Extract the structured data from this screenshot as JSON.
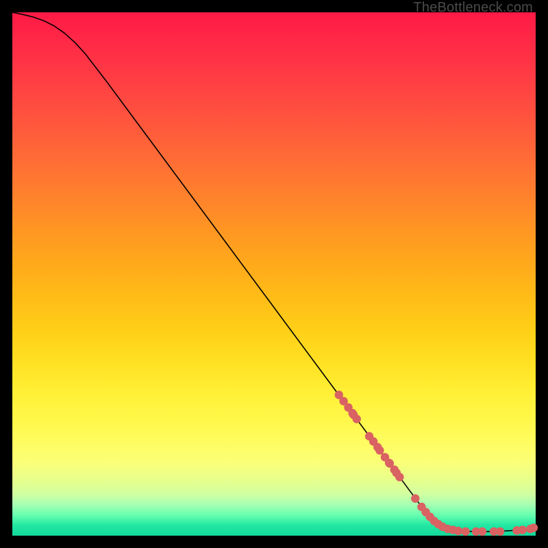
{
  "watermark": "TheBottleneck.com",
  "colors": {
    "dot": "#d96262",
    "curve": "#000000",
    "page_bg": "#000000"
  },
  "chart_data": {
    "type": "line",
    "title": "",
    "xlabel": "",
    "ylabel": "",
    "xlim": [
      0,
      100
    ],
    "ylim": [
      0,
      100
    ],
    "grid": false,
    "legend": false,
    "series": [
      {
        "name": "curve",
        "kind": "line",
        "x": [
          0,
          2,
          4,
          6,
          8,
          10,
          12,
          14,
          18,
          22,
          26,
          30,
          34,
          38,
          42,
          46,
          50,
          54,
          58,
          62,
          66,
          70,
          74,
          78,
          80,
          82,
          84,
          86,
          88,
          90,
          92,
          94,
          96,
          98,
          100
        ],
        "y": [
          100,
          99.6,
          99.1,
          98.4,
          97.4,
          96.0,
          94.2,
          92.0,
          86.8,
          81.4,
          76.0,
          70.6,
          65.2,
          59.8,
          54.4,
          49.0,
          43.6,
          38.2,
          32.8,
          27.4,
          22.0,
          16.6,
          11.2,
          5.8,
          3.6,
          1.9,
          1.2,
          0.9,
          0.8,
          0.8,
          0.8,
          0.9,
          1.0,
          1.2,
          1.5
        ]
      },
      {
        "name": "highlighted-points",
        "kind": "scatter",
        "x": [
          62.4,
          63.3,
          64.2,
          65.0,
          65.2,
          65.8,
          68.2,
          69.0,
          69.8,
          70.2,
          71.2,
          72.0,
          72.1,
          73.0,
          73.4,
          74.0,
          77.0,
          78.2,
          79.0,
          79.8,
          80.6,
          81.4,
          82.2,
          83.2,
          84.2,
          85.2,
          86.6,
          88.6,
          89.8,
          92.0,
          93.2,
          96.4,
          97.5,
          99.0,
          99.6
        ],
        "y": [
          26.9,
          25.7,
          24.5,
          23.4,
          23.1,
          22.3,
          19.0,
          18.0,
          16.9,
          16.3,
          15.0,
          13.9,
          13.8,
          12.6,
          12.0,
          11.2,
          7.1,
          5.5,
          4.5,
          3.6,
          2.8,
          2.2,
          1.7,
          1.3,
          1.1,
          0.9,
          0.8,
          0.8,
          0.8,
          0.8,
          0.8,
          1.0,
          1.1,
          1.3,
          1.5
        ]
      }
    ]
  }
}
